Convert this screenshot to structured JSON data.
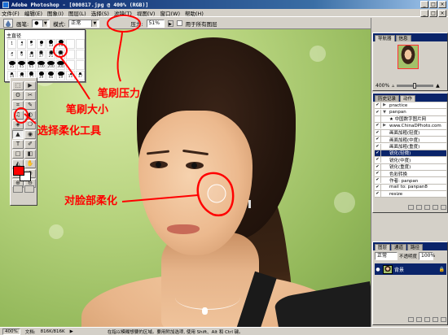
{
  "window": {
    "title": "Adobe Photoshop - [000817.jpg @ 400% (RGB)]",
    "minimize": "_",
    "maximize": "□",
    "close": "×"
  },
  "menu": {
    "items": [
      "文件(F)",
      "编辑(E)",
      "图象(I)",
      "图层(L)",
      "选择(S)",
      "滤镜(T)",
      "视图(V)",
      "窗口(W)",
      "帮助(H)"
    ]
  },
  "options": {
    "brush_label": "画笔:",
    "mode_label": "模式:",
    "mode_value": "正常",
    "pressure_label": "压力:",
    "pressure_value": "51%",
    "use_all_layers_label": "用于所有图层"
  },
  "brush_picker": {
    "master_label": "主直径",
    "sizes": [
      "1",
      "3",
      "5",
      "9",
      "13",
      "19",
      "",
      "",
      "5",
      "9",
      "13",
      "17",
      "21",
      "27",
      "",
      "",
      "35",
      "45",
      "65",
      "100",
      "200",
      "300",
      "",
      "",
      "14",
      "24",
      "27",
      "39",
      "46",
      "59",
      "11",
      "17"
    ]
  },
  "annotations": {
    "pressure": "笔刷压力",
    "brush_size": "笔刷大小",
    "blur_tool": "选择柔化工具",
    "face_blur": "对脸部柔化"
  },
  "toolbox": {
    "tools": [
      "⬚",
      "▶",
      "ʘ",
      "✂",
      "⌗",
      "✎",
      "♫",
      "◐",
      "◈",
      "❍",
      "▲",
      "◉",
      "T",
      "✐",
      "□",
      "◧",
      "◭",
      "✋",
      "⚲",
      "⊙",
      "⊕",
      "⊖"
    ],
    "colors": {
      "foreground": "#ff0000",
      "background": "#ffffff"
    }
  },
  "navigator": {
    "tabs": [
      "导航器",
      "信息"
    ],
    "zoom": "400%"
  },
  "history": {
    "tabs": [
      "历史记录",
      "动作"
    ],
    "rows": [
      {
        "check": "✔",
        "expand": "▶",
        "label": "practice"
      },
      {
        "check": "✔",
        "expand": "▼",
        "label": "panpan"
      },
      {
        "check": "",
        "expand": "",
        "label": "★ 中国数字图片网"
      },
      {
        "check": "✔",
        "expand": "▶",
        "label": "www.ChinaDPhoto.com"
      },
      {
        "check": "✔",
        "expand": "",
        "label": "画面加粗(轻度)"
      },
      {
        "check": "✔",
        "expand": "",
        "label": "画面加粗(中度)"
      },
      {
        "check": "✔",
        "expand": "",
        "label": "画面加粗(重度)"
      },
      {
        "check": "✔",
        "expand": "",
        "label": "锐化(轻微)"
      },
      {
        "check": "✔",
        "expand": "",
        "label": "锐化(中度)"
      },
      {
        "check": "✔",
        "expand": "",
        "label": "锐化(重度)"
      },
      {
        "check": "✔",
        "expand": "",
        "label": "色彩转换"
      },
      {
        "check": "✔",
        "expand": "",
        "label": "作者: panpan"
      },
      {
        "check": "✔",
        "expand": "",
        "label": "mail to: panpan8"
      },
      {
        "check": "✔",
        "expand": "",
        "label": "resize"
      }
    ],
    "selected_index": 7
  },
  "layers": {
    "tabs": [
      "图层",
      "通道",
      "路径"
    ],
    "mode": "正常",
    "opacity_label": "不透明度",
    "opacity": "100%",
    "layer_name": "背景",
    "lock_icon": "🔒"
  },
  "status": {
    "zoom": "400%",
    "doc_label": "文档:",
    "doc_size": "816K/816K",
    "hint": "在指以模糊想要的区域。要用附加选项, 使用 Shift、Alt 和 Ctrl 键。"
  },
  "colors": {
    "title_bar": "#0a246a",
    "annotation": "#ff0000",
    "selection": "#0a246a"
  }
}
